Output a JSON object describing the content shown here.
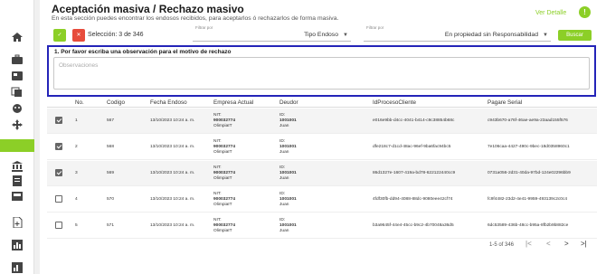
{
  "header": {
    "title": "Aceptación masiva / Rechazo masivo",
    "subtitle": "En esta sección puedes encontrar los endosos recibidos, para aceptarlos ó rechazarlos de forma masiva.",
    "detail_link": "Ver Detalle",
    "info_label": "!"
  },
  "sidebar": {
    "icons": [
      "home-icon",
      "briefcase-icon",
      "id-card-icon",
      "stacked-docs-icon",
      "face-icon",
      "move-arrows-icon",
      "active-item",
      "bank-icon",
      "contract-icon",
      "inbox-icon",
      "add-document-icon",
      "bar-chart-icon",
      "bar-chart-2-icon"
    ]
  },
  "toolbar": {
    "accept_label": "✓",
    "reject_label": "✕",
    "selection_text": "Selección: 3 de 346",
    "filter1_caption": "Filtrar por",
    "filter1_value": "Tipo Endoso",
    "filter2_caption": "Filtrar por",
    "filter2_value": "En propiedad sin Responsabilidad",
    "search_label": "Buscar"
  },
  "observation": {
    "label": "1. Por favor escriba una observación para el motivo de rechazo",
    "placeholder": "Observaciones"
  },
  "table": {
    "headers": [
      "No.",
      "Codigo",
      "Fecha Endoso",
      "Empresa Actual",
      "Deudor",
      "IdProcesoCliente",
      "Pagare Serial"
    ],
    "rows": [
      {
        "no": "1",
        "codigo": "567",
        "fecha": "13/10/2023 10:24 a. m.",
        "nit_label": "NIT:",
        "nit": "900032774",
        "empresa": "OlimpiaIT",
        "id_label": "ID:",
        "deudor_id": "1001001",
        "deudor": "Juan",
        "proceso": "e016e9bb-d4cc-4041-b414-c9c38854b68c",
        "pagare": "c943b670-a76f-46ae-ae9a-23aad155f576",
        "checked": true
      },
      {
        "no": "2",
        "codigo": "568",
        "fecha": "13/10/2023 10:24 a. m.",
        "nit_label": "NIT:",
        "nit": "900032774",
        "empresa": "OlimpiaIT",
        "id_label": "ID:",
        "deudor_id": "1001001",
        "deudor": "Juan",
        "proceso": "dfe218c7-d1cd-48ac-96ef-9ba6fac94bc5",
        "pagare": "7e106caa-4427-490c-9bec-18d0358960c1",
        "checked": true
      },
      {
        "no": "3",
        "codigo": "569",
        "fecha": "13/10/2023 10:24 a. m.",
        "nit_label": "NIT:",
        "nit": "900032774",
        "empresa": "OlimpiaIT",
        "id_label": "ID:",
        "deudor_id": "1001001",
        "deudor": "Juan",
        "proceso": "86d1327e-1607-419a-bd78-622122440cc9",
        "pagare": "0731a056-2d31-40da-97bd-124e02296bb9",
        "checked": true
      },
      {
        "no": "4",
        "codigo": "570",
        "fecha": "13/10/2023 10:24 a. m.",
        "nit_label": "NIT:",
        "nit": "900032774",
        "empresa": "OlimpiaIT",
        "id_label": "ID:",
        "deudor_id": "1001001",
        "deudor": "Juan",
        "proceso": "4fdf30fb-dd94-4088-88dc-9080eee42cf74",
        "pagare": "fc9f4482-23d2-4e41-9959-493139c2c0c4",
        "checked": false
      },
      {
        "no": "5",
        "codigo": "571",
        "fecha": "13/10/2023 10:24 a. m.",
        "nit_label": "NIT:",
        "nit": "900032774",
        "empresa": "OlimpiaIT",
        "id_label": "ID:",
        "deudor_id": "1001001",
        "deudor": "Juan",
        "proceso": "b3a9645f-44e4-45cc-b9c2-4b70048a36d5",
        "pagare": "6dc53589-436b-48cc-b95a-8fb2b9b882ce",
        "checked": false
      }
    ]
  },
  "pagination": {
    "text": "1-5 of 346",
    "first": "|<",
    "prev": "<",
    "next": ">",
    "last": ">|"
  },
  "colors": {
    "accent": "#8ccf27",
    "reject": "#e74c3c",
    "highlight_border": "#2424b8"
  }
}
